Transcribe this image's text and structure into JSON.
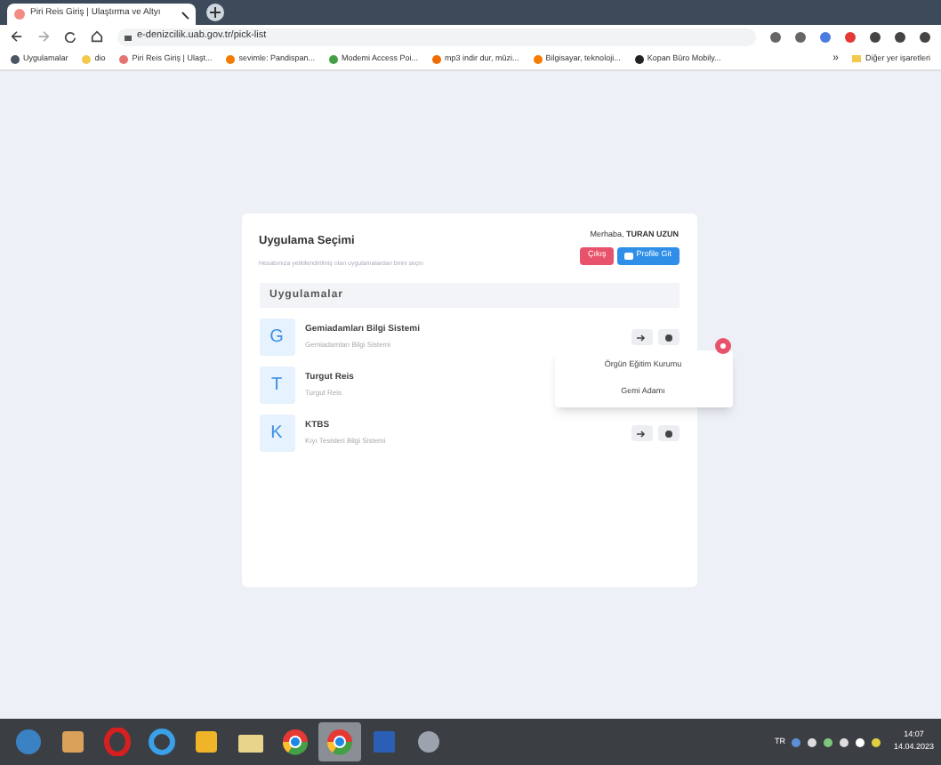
{
  "browser": {
    "tab_title": "Piri Reis Giriş | Ulaştırma ve Altyı",
    "url": "e-denizcilik.uab.gov.tr/pick-list",
    "bookmarks": [
      {
        "label": "Uygulamalar",
        "color": "#4b5563"
      },
      {
        "label": "dio",
        "color": "#f2c94c"
      },
      {
        "label": "Piri Reis Giriş | Ulaşt...",
        "color": "#e57373"
      },
      {
        "label": "sevimle: Pandispan...",
        "color": "#f57c00"
      },
      {
        "label": "Modemi Access Poi...",
        "color": "#43a047"
      },
      {
        "label": "mp3 indir dur, müzi...",
        "color": "#ef6c00"
      },
      {
        "label": "Bilgisayar, teknoloji...",
        "color": "#f57c00"
      },
      {
        "label": "Kopan Büro Mobily...",
        "color": "#222222"
      }
    ],
    "overflow": "»",
    "other_bookmarks": "Diğer yer işaretleri"
  },
  "card": {
    "title": "Uygulama Seçimi",
    "subtitle": "Hesabınıza yetkilendirilmiş olan uygulamalardan birini seçin",
    "greeting": "Merhaba,",
    "user": "TURAN UZUN",
    "logout": "Çıkış",
    "profile": "Profile Git",
    "section": "Uygulamalar",
    "apps": [
      {
        "letter": "G",
        "name": "Gemiadamları Bilgi Sistemi",
        "desc": "Gemiadamları Bilgi Sistemi",
        "actions": true
      },
      {
        "letter": "T",
        "name": "Turgut Reis",
        "desc": "Turgut Reis",
        "actions": false
      },
      {
        "letter": "K",
        "name": "KTBS",
        "desc": "Kıyı Tesisleri Bilgi Sistemi",
        "actions": true
      }
    ]
  },
  "menu": {
    "items": [
      "Örgün Eğitim Kurumu",
      "Gemi Adamı"
    ]
  },
  "taskbar": {
    "apps": [
      {
        "kind": "start",
        "selected": false
      },
      {
        "kind": "media",
        "selected": false
      },
      {
        "kind": "opera",
        "selected": false
      },
      {
        "kind": "ie",
        "selected": false
      },
      {
        "kind": "outlook",
        "selected": false
      },
      {
        "kind": "folder",
        "selected": false
      },
      {
        "kind": "chrome",
        "selected": false
      },
      {
        "kind": "chrome",
        "selected": true
      },
      {
        "kind": "word",
        "selected": false
      },
      {
        "kind": "tool",
        "selected": false
      }
    ],
    "language": "TR",
    "time": "14:07",
    "date": "14.04.2023"
  }
}
